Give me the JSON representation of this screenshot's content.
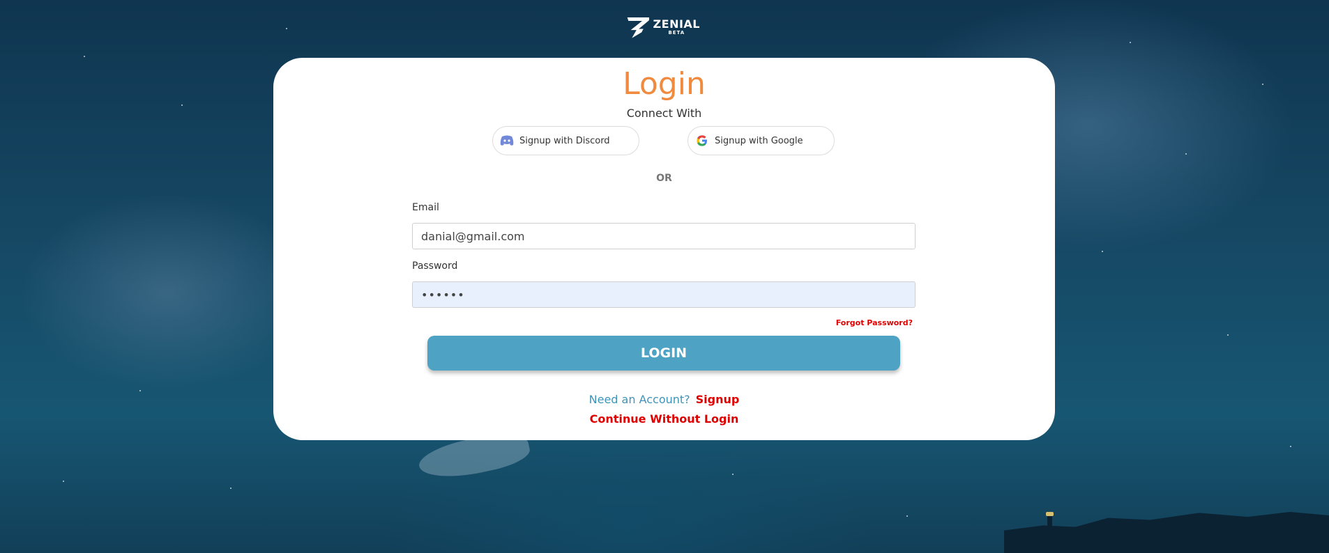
{
  "brand": {
    "name": "ZENIAL",
    "badge": "BETA",
    "logo_icon": "zenial-logo-icon"
  },
  "login": {
    "title": "Login",
    "connect_label": "Connect With",
    "discord_button": "Signup with Discord",
    "google_button": "Signup with Google",
    "separator": "OR",
    "email_label": "Email",
    "email_value": "danial@gmail.com",
    "password_label": "Password",
    "password_value": "••••••",
    "forgot_link": "Forgot Password?",
    "submit_label": "LOGIN",
    "need_account": "Need an Account?",
    "signup_link": "Signup",
    "continue_link": "Continue Without Login"
  },
  "icons": {
    "discord": "discord-icon",
    "google": "google-icon"
  },
  "colors": {
    "title_orange": "#ef8a3f",
    "button_blue": "#4ea3c4",
    "link_red": "#e00000",
    "account_blue": "#3f93b8",
    "password_bg": "#e8f0fe"
  }
}
